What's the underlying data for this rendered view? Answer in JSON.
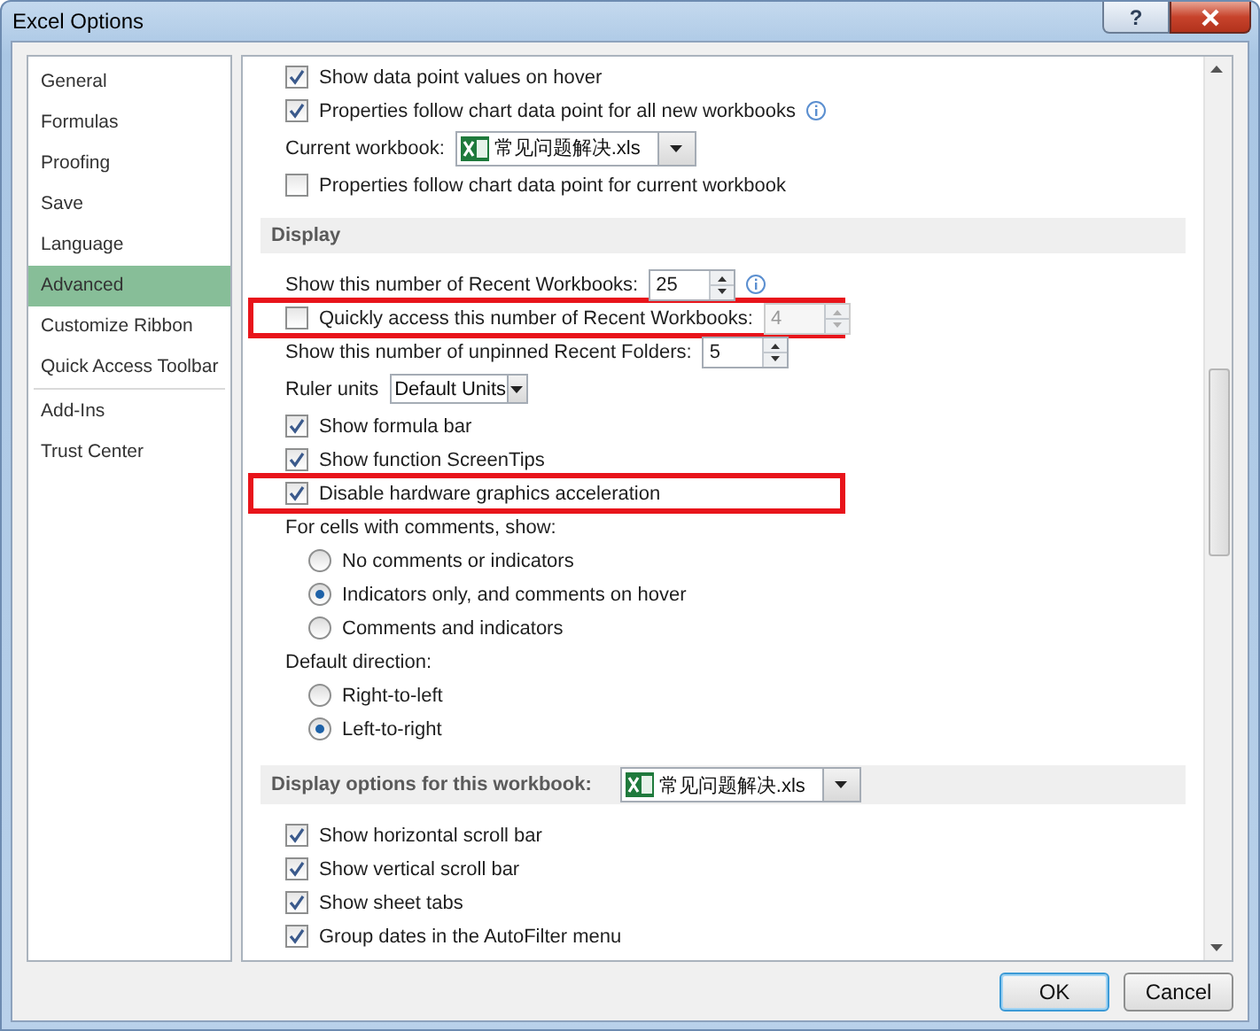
{
  "window": {
    "title": "Excel Options",
    "help": "?"
  },
  "sidebar": {
    "groups": [
      [
        {
          "label": "General",
          "selected": false
        },
        {
          "label": "Formulas",
          "selected": false
        },
        {
          "label": "Proofing",
          "selected": false
        },
        {
          "label": "Save",
          "selected": false
        },
        {
          "label": "Language",
          "selected": false
        },
        {
          "label": "Advanced",
          "selected": true
        },
        {
          "label": "Customize Ribbon",
          "selected": false
        },
        {
          "label": "Quick Access Toolbar",
          "selected": false
        }
      ],
      [
        {
          "label": "Add-Ins",
          "selected": false
        },
        {
          "label": "Trust Center",
          "selected": false
        }
      ]
    ]
  },
  "content": {
    "rows": [
      {
        "kind": "checkbox",
        "label": "Show data point values on hover",
        "checked": true,
        "info": false,
        "highlighted": false
      },
      {
        "kind": "checkbox",
        "label": "Properties follow chart data point for all new workbooks",
        "checked": true,
        "info": true,
        "highlighted": false
      },
      {
        "kind": "dropdown",
        "label": "Current workbook:",
        "value": "常见问题解决.xls"
      },
      {
        "kind": "checkbox",
        "label": "Properties follow chart data point for current workbook",
        "checked": false,
        "info": false,
        "highlighted": false
      },
      {
        "kind": "section",
        "label": "Display"
      },
      {
        "kind": "spinner",
        "label": "Show this number of Recent Workbooks:",
        "value": "25",
        "info": true,
        "disabled": false,
        "highlighted": false
      },
      {
        "kind": "check_spinner",
        "label": "Quickly access this number of Recent Workbooks:",
        "checked": false,
        "value": "4",
        "info": false,
        "disabled": true,
        "highlighted": true
      },
      {
        "kind": "spinner",
        "label": "Show this number of unpinned Recent Folders:",
        "value": "5",
        "info": false,
        "disabled": false,
        "highlighted": false
      },
      {
        "kind": "select",
        "label": "Ruler units",
        "value": "Default Units"
      },
      {
        "kind": "checkbox",
        "label": "Show formula bar",
        "checked": true,
        "info": false,
        "highlighted": false
      },
      {
        "kind": "checkbox",
        "label": "Show function ScreenTips",
        "checked": true,
        "info": false,
        "highlighted": false
      },
      {
        "kind": "checkbox",
        "label": "Disable hardware graphics acceleration",
        "checked": true,
        "info": false,
        "highlighted": true
      },
      {
        "kind": "label",
        "label": "For cells with comments, show:"
      },
      {
        "kind": "radio",
        "label": "No comments or indicators",
        "selected": false
      },
      {
        "kind": "radio",
        "label": "Indicators only, and comments on hover",
        "selected": true
      },
      {
        "kind": "radio",
        "label": "Comments and indicators",
        "selected": false
      },
      {
        "kind": "label",
        "label": "Default direction:"
      },
      {
        "kind": "radio",
        "label": "Right-to-left",
        "selected": false
      },
      {
        "kind": "radio",
        "label": "Left-to-right",
        "selected": true
      },
      {
        "kind": "section_dropdown",
        "label": "Display options for this workbook:",
        "value": "常见问题解决.xls"
      },
      {
        "kind": "checkbox",
        "label": "Show horizontal scroll bar",
        "checked": true,
        "info": false,
        "highlighted": false
      },
      {
        "kind": "checkbox",
        "label": "Show vertical scroll bar",
        "checked": true,
        "info": false,
        "highlighted": false
      },
      {
        "kind": "checkbox",
        "label": "Show sheet tabs",
        "checked": true,
        "info": false,
        "highlighted": false
      },
      {
        "kind": "checkbox",
        "label": "Group dates in the AutoFilter menu",
        "checked": true,
        "info": false,
        "highlighted": false
      }
    ]
  },
  "buttons": [
    {
      "label": "OK",
      "default": true
    },
    {
      "label": "Cancel",
      "default": false
    }
  ]
}
